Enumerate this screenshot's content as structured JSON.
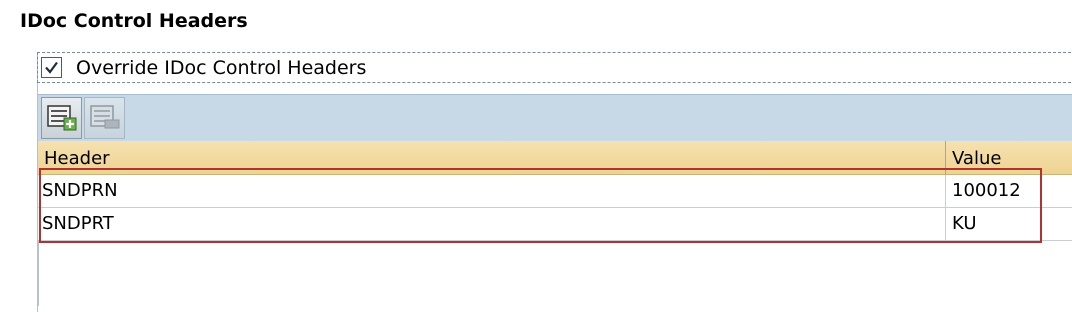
{
  "section": {
    "title": "IDoc Control Headers"
  },
  "override": {
    "label": "Override IDoc Control Headers",
    "checked": true
  },
  "toolbar": {
    "buttons": [
      {
        "icon": "add-row-icon",
        "enabled": true
      },
      {
        "icon": "delete-row-icon",
        "enabled": false
      }
    ]
  },
  "table": {
    "columns": {
      "header": "Header",
      "value": "Value"
    },
    "rows": [
      {
        "header": "SNDPRN",
        "value": "100012"
      },
      {
        "header": "SNDPRT",
        "value": "KU"
      }
    ]
  },
  "colors": {
    "toolbar_bg": "#c7d9e6",
    "column_header_bg": "#eed392",
    "highlight_border": "#b1332f"
  }
}
